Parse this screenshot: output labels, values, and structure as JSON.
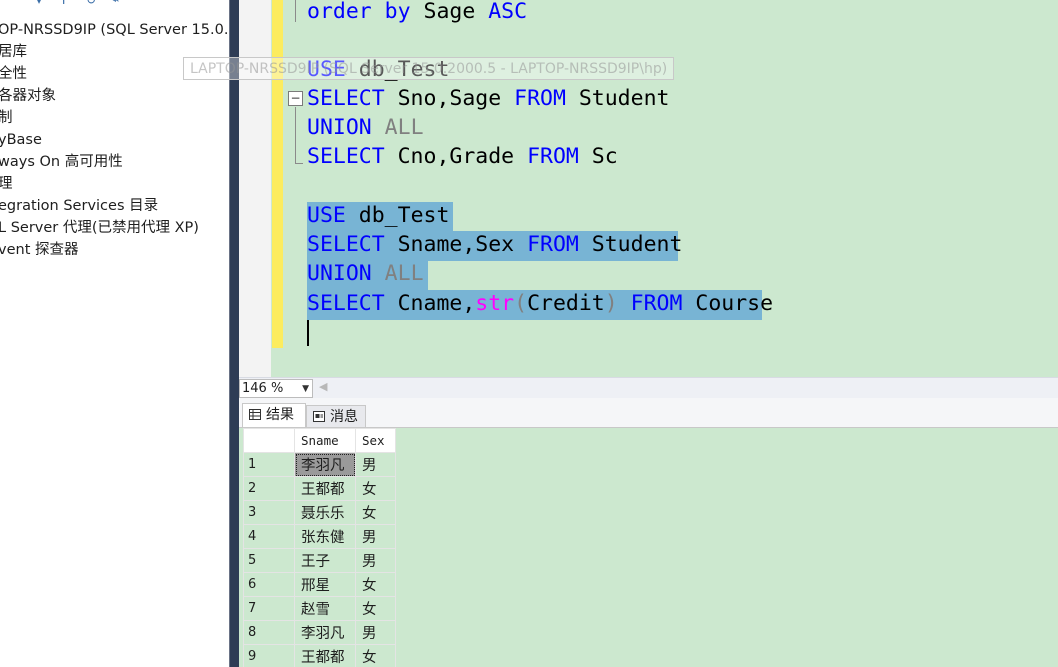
{
  "explorer": {
    "items": [
      "OP-NRSSD9IP (SQL Server 15.0.2",
      "居库",
      "全性",
      "各器对象",
      "制",
      "yBase",
      "ways On 高可用性",
      "理",
      "egration Services 目录",
      "L Server 代理(已禁用代理 XP)",
      "vent 探查器"
    ]
  },
  "editor": {
    "tooltip": "LAPTOP-NRSSD9IP (SQL Server 15.0.2000.5 - LAPTOP-NRSSD9IP\\hp)",
    "lines": {
      "l1": {
        "kw1": "order by",
        "t1": " Sage ",
        "kw2": "ASC"
      },
      "l2": {
        "kw1": "USE",
        "t1": " db_Test"
      },
      "l3": {
        "kw1": "SELECT",
        "t1": " Sno,Sage ",
        "kw2": "FROM",
        "t2": " Student"
      },
      "l4": {
        "kw1": "UNION",
        "g1": " ALL"
      },
      "l5": {
        "kw1": "SELECT",
        "t1": " Cno,Grade ",
        "kw2": "FROM",
        "t2": " Sc"
      },
      "l6": {
        "kw1": "USE",
        "t1": " db_Test"
      },
      "l7": {
        "kw1": "SELECT",
        "t1": " Sname,Sex ",
        "kw2": "FROM",
        "t2": " Student"
      },
      "l8": {
        "kw1": "UNION",
        "g1": " ALL"
      },
      "l9": {
        "kw1": "SELECT",
        "t1": " Cname,",
        "fn": "str",
        "g1": "(",
        "t2": "Credit",
        "g2": ")",
        "t3": " ",
        "kw2": "FROM",
        "t4": " Course"
      }
    }
  },
  "zoom": {
    "value": "146 %"
  },
  "results_tabs": {
    "results": "结果",
    "messages": "消息"
  },
  "grid": {
    "columns": [
      "Sname",
      "Sex"
    ],
    "rows": [
      {
        "n": "1",
        "name": "李羽凡",
        "sex": "男"
      },
      {
        "n": "2",
        "name": "王都都",
        "sex": "女"
      },
      {
        "n": "3",
        "name": "聂乐乐",
        "sex": "女"
      },
      {
        "n": "4",
        "name": "张东健",
        "sex": "男"
      },
      {
        "n": "5",
        "name": "王子",
        "sex": "男"
      },
      {
        "n": "6",
        "name": "邢星",
        "sex": "女"
      },
      {
        "n": "7",
        "name": "赵雪",
        "sex": "女"
      },
      {
        "n": "8",
        "name": "李羽凡",
        "sex": "男"
      },
      {
        "n": "9",
        "name": "王都都",
        "sex": "女"
      }
    ]
  },
  "colors": {
    "editor_bg": "#cce8cf",
    "selection": "#78b4d4",
    "keyword": "#0000ff",
    "function": "#ff00ff"
  }
}
